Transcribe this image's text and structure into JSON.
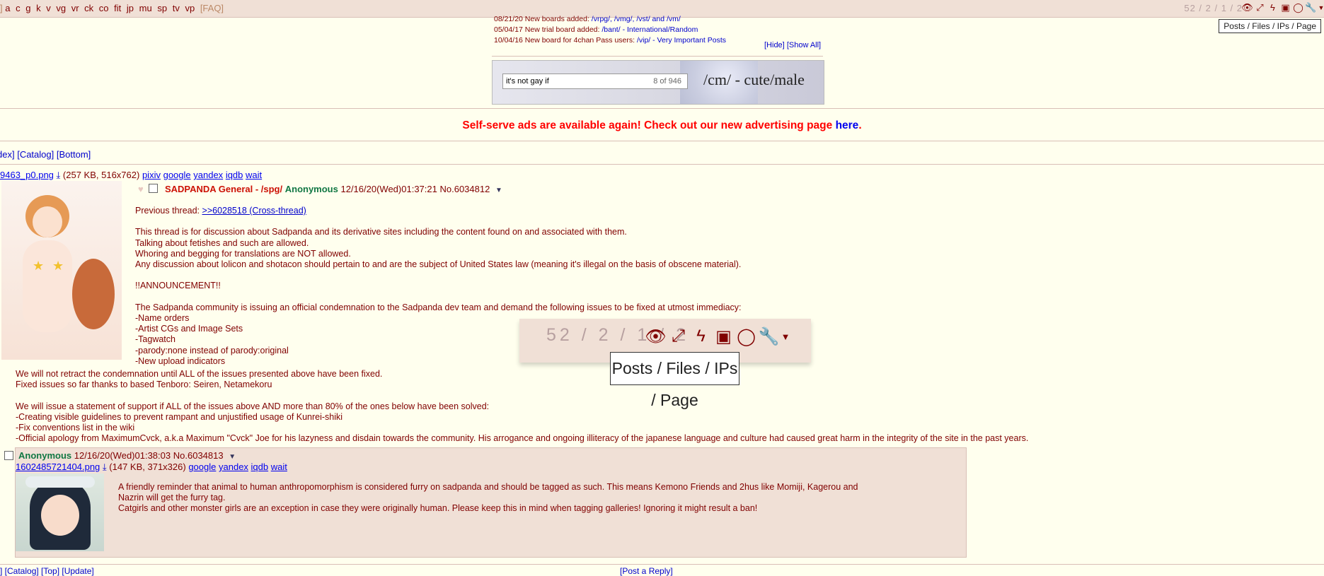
{
  "topbar": {
    "bracket_open": "]",
    "boards": [
      "a",
      "c",
      "g",
      "k",
      "v",
      "vg",
      "vr",
      "ck",
      "co",
      "fit",
      "jp",
      "mu",
      "sp",
      "tv",
      "vp"
    ],
    "faq": "[FAQ]",
    "stats": "52 / 2 / 1 / 2",
    "tooltip": "Posts / Files / IPs / Page"
  },
  "news": [
    {
      "date": "08/21/20",
      "text": "New boards added:",
      "links": "/vrpg/, /vmg/, /vst/ and /vm/"
    },
    {
      "date": "05/04/17",
      "text": "New trial board added:",
      "links": "/bant/ - International/Random"
    },
    {
      "date": "10/04/16",
      "text": "New board for 4chan Pass users:",
      "links": "/vip/ - Very Important Posts"
    }
  ],
  "news_links": {
    "hide": "[Hide]",
    "show_all": "[Show All]"
  },
  "banner": {
    "search_value": "it's not gay if",
    "search_count": "8 of 946",
    "title": "/cm/ - cute/male"
  },
  "ad": {
    "text": "Self-serve ads are available again! Check out our new advertising page",
    "link": "here",
    "tail": "."
  },
  "threadnav": {
    "index": "dex]",
    "catalog": "[Catalog]",
    "bottom": "[Bottom]"
  },
  "op": {
    "filename": "9463_p0.png",
    "fileinfo": "(257 KB, 516x762)",
    "search_links": [
      "pixiv",
      "google",
      "yandex",
      "iqdb",
      "wait"
    ],
    "subject": "SADPANDA General - /spg/",
    "name": "Anonymous",
    "datetime": "12/16/20(Wed)01:37:21",
    "postnum": "No.6034812",
    "prev_label": "Previous thread:",
    "prev_link": ">>6028518 (Cross-thread)",
    "lines_a": [
      "This thread is for discussion about Sadpanda and its derivative sites including the content found on and associated with them.",
      "Talking about fetishes and such are allowed.",
      "Whoring and begging for translations are NOT allowed.",
      "Any discussion about lolicon and shotacon should pertain to and are the subject of United States law (meaning it's illegal on the basis of obscene material)."
    ],
    "announcement": "!!ANNOUNCEMENT!!",
    "lines_b": [
      "The Sadpanda community is issuing an official condemnation to the Sadpanda dev team and demand the following issues to be fixed at utmost immediacy:",
      "-Name orders",
      "-Artist CGs and Image Sets",
      "-Tagwatch",
      "-parody:none instead of parody:original",
      "-New upload indicators"
    ],
    "lines_c": [
      "We will not retract the condemnation until ALL of the issues presented above have been fixed.",
      "Fixed issues so far thanks to based Tenboro: Seiren, Netamekoru"
    ],
    "lines_d": [
      "We will issue a statement of support if ALL of the issues above AND more than 80% of the ones below have been solved:",
      "-Creating visible guidelines to prevent rampant and unjustified usage of Kunrei-shiki",
      "-Fix conventions list in the wiki",
      "-Official apology from MaximumCvck, a.k.a Maximum \"Cvck\" Joe for his lazyness and disdain towards the community. His arrogance and ongoing illiteracy of the japanese language and culture had caused great harm in the integrity of the site in the past years."
    ]
  },
  "zoom": {
    "stats": "52 / 2 / 1 / 2",
    "tooltip": "Posts / Files / IPs / Page"
  },
  "reply": {
    "name": "Anonymous",
    "datetime": "12/16/20(Wed)01:38:03",
    "postnum": "No.6034813",
    "filename": "1602485721404.png",
    "fileinfo": "(147 KB, 371x326)",
    "search_links": [
      "google",
      "yandex",
      "iqdb",
      "wait"
    ],
    "lines": [
      "A friendly reminder that animal to human anthropomorphism is considered furry on sadpanda and should be tagged as such. This means Kemono Friends and 2hus like Momiji, Kagerou and",
      "Nazrin will get the furry tag.",
      "Catgirls and other monster girls are an exception in case they were originally human. Please keep this in mind when tagging galleries! Ignoring it might result a ban!"
    ]
  },
  "bottom": {
    "left": "] [Catalog] [Top] [Update]",
    "right": "[Post a Reply]"
  }
}
